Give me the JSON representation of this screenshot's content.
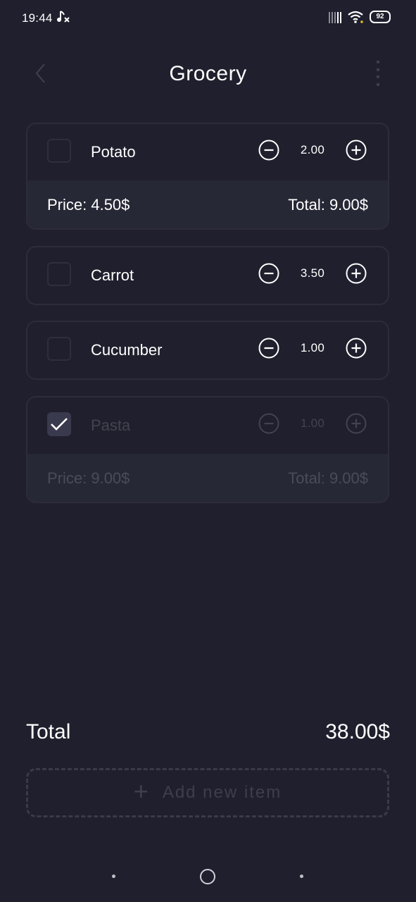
{
  "status": {
    "time": "19:44",
    "battery": "92"
  },
  "header": {
    "title": "Grocery"
  },
  "items": [
    {
      "name": "Potato",
      "qty": "2.00",
      "price": "Price: 4.50$",
      "total": "Total: 9.00$",
      "checked": false
    },
    {
      "name": "Carrot",
      "qty": "3.50",
      "checked": false
    },
    {
      "name": "Cucumber",
      "qty": "1.00",
      "checked": false
    },
    {
      "name": "Pasta",
      "qty": "1.00",
      "price": "Price: 9.00$",
      "total": "Total: 9.00$",
      "checked": true
    }
  ],
  "summary": {
    "label": "Total",
    "value": "38.00$"
  },
  "add_button": {
    "label": "Add new item"
  },
  "colors": {
    "background": "#1f1f2d",
    "card_border": "#2c2c3b",
    "price_row": "#272836",
    "checkbox_checked": "#3a3a4e"
  }
}
